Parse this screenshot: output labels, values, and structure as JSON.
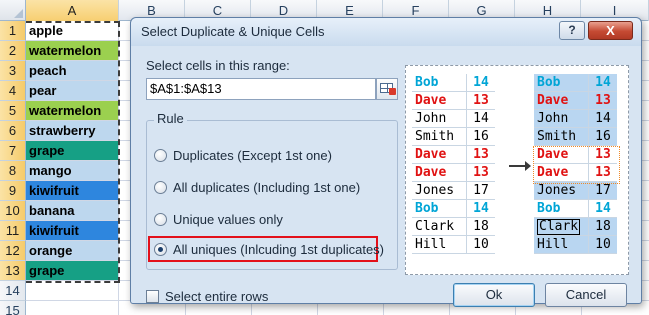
{
  "sheet": {
    "columns": [
      "A",
      "B",
      "C",
      "D",
      "E",
      "F",
      "G",
      "H",
      "I"
    ],
    "selected_column": "A",
    "rows": [
      {
        "num": "1",
        "value": "apple",
        "fill": "#ffffff"
      },
      {
        "num": "2",
        "value": "watermelon",
        "fill": "#9bd04f"
      },
      {
        "num": "3",
        "value": "peach",
        "fill": "#bdd7ee"
      },
      {
        "num": "4",
        "value": "pear",
        "fill": "#bdd7ee"
      },
      {
        "num": "5",
        "value": "watermelon",
        "fill": "#9bd04f"
      },
      {
        "num": "6",
        "value": "strawberry",
        "fill": "#bdd7ee"
      },
      {
        "num": "7",
        "value": "grape",
        "fill": "#16a085"
      },
      {
        "num": "8",
        "value": "mango",
        "fill": "#bdd7ee"
      },
      {
        "num": "9",
        "value": "kiwifruit",
        "fill": "#2e86de"
      },
      {
        "num": "10",
        "value": "banana",
        "fill": "#bdd7ee"
      },
      {
        "num": "11",
        "value": "kiwifruit",
        "fill": "#2e86de"
      },
      {
        "num": "12",
        "value": "orange",
        "fill": "#bdd7ee"
      },
      {
        "num": "13",
        "value": "grape",
        "fill": "#16a085"
      },
      {
        "num": "14",
        "value": "",
        "fill": "#ffffff"
      },
      {
        "num": "15",
        "value": "",
        "fill": "#ffffff"
      }
    ]
  },
  "dialog": {
    "title": "Select Duplicate & Unique Cells",
    "help_label": "?",
    "close_label": "X",
    "range_label": "Select cells in this range:",
    "range_value": "$A$1:$A$13",
    "rule_label": "Rule",
    "options": [
      {
        "label": "Duplicates (Except 1st one)",
        "checked": false
      },
      {
        "label": "All duplicates (Including 1st one)",
        "checked": false
      },
      {
        "label": "Unique values only",
        "checked": false
      },
      {
        "label": "All uniques (Inlcuding 1st duplicates)",
        "checked": true
      }
    ],
    "select_entire_rows_label": "Select entire rows",
    "ok_label": "Ok",
    "cancel_label": "Cancel",
    "highlight_color": "#e3101a"
  },
  "preview": {
    "before": [
      {
        "name": "Bob",
        "value": "14",
        "style": "blue",
        "tinted": false
      },
      {
        "name": "Dave",
        "value": "13",
        "style": "red",
        "tinted": false
      },
      {
        "name": "John",
        "value": "14",
        "style": "black",
        "tinted": false
      },
      {
        "name": "Smith",
        "value": "16",
        "style": "black",
        "tinted": false
      },
      {
        "name": "Dave",
        "value": "13",
        "style": "red",
        "tinted": false
      },
      {
        "name": "Dave",
        "value": "13",
        "style": "red",
        "tinted": false
      },
      {
        "name": "Jones",
        "value": "17",
        "style": "black",
        "tinted": false
      },
      {
        "name": "Bob",
        "value": "14",
        "style": "blue",
        "tinted": false
      },
      {
        "name": "Clark",
        "value": "18",
        "style": "black",
        "tinted": false
      },
      {
        "name": "Hill",
        "value": "10",
        "style": "black",
        "tinted": false
      }
    ],
    "after": [
      {
        "name": "Bob",
        "value": "14",
        "style": "blue",
        "tinted": true
      },
      {
        "name": "Dave",
        "value": "13",
        "style": "red",
        "tinted": true
      },
      {
        "name": "John",
        "value": "14",
        "style": "black",
        "tinted": true
      },
      {
        "name": "Smith",
        "value": "16",
        "style": "black",
        "tinted": true
      },
      {
        "name": "Dave",
        "value": "13",
        "style": "red",
        "tinted": false
      },
      {
        "name": "Dave",
        "value": "13",
        "style": "red",
        "tinted": false
      },
      {
        "name": "Jones",
        "value": "17",
        "style": "black",
        "tinted": true
      },
      {
        "name": "Bob",
        "value": "14",
        "style": "blue",
        "tinted": false
      },
      {
        "name": "Clark",
        "value": "18",
        "style": "black",
        "tinted": true,
        "boxed": true
      },
      {
        "name": "Hill",
        "value": "10",
        "style": "black",
        "tinted": true
      }
    ],
    "colors": {
      "blue": "#00a5d6",
      "red": "#e01212",
      "selection": "#b9d6f1"
    }
  }
}
